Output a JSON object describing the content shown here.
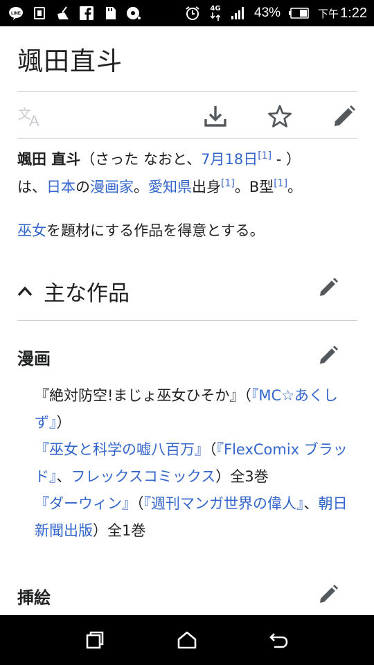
{
  "status_bar": {
    "battery_percent": "43%",
    "ampm": "下午",
    "time": "1:22",
    "network": "4G",
    "left_icons": [
      "line-icon",
      "sim-card-icon",
      "cleaner-icon",
      "facebook-icon",
      "sd-card-icon",
      "music-icon"
    ],
    "right_icons": [
      "alarm-icon",
      "data-arrows-icon",
      "signal-icon",
      "battery-icon"
    ]
  },
  "page": {
    "title": "颯田直斗",
    "actions": {
      "language": "language-icon",
      "download": "download-icon",
      "watch": "star-icon",
      "edit": "pencil-icon"
    }
  },
  "intro": {
    "name": "颯田 直斗",
    "reading_open": "（さった なおと、",
    "birthday_link": "7月18日",
    "ref1": "[1]",
    "reading_close": " - ）",
    "line2_start": "は、",
    "japan_link": "日本",
    "no": "の",
    "manga_artist_link": "漫画家",
    "period1": "。",
    "aichi_link": "愛知県",
    "born": "出身",
    "ref2": "[1]",
    "blood": "。B型",
    "ref3": "[1]",
    "period2": "。"
  },
  "intro2": {
    "miko_link": "巫女",
    "rest": "を題材にする作品を得意とする。"
  },
  "section_works": {
    "heading": "主な作品",
    "manga_heading": "漫画",
    "illust_heading": "挿絵"
  },
  "works": {
    "w1_title": "『絶対防空!まじょ巫女ひそか』",
    "w1_paren_open": "（",
    "w1_mag_link": "『MC☆あくしず』",
    "w1_paren_close": "）",
    "w2_title_link": "『巫女と科学の嘘八百万』",
    "w2_paren_open": "（",
    "w2_mag_link": "『FlexComix ブラッド』",
    "w2_sep": "、",
    "w2_label_link": "フレックスコミックス",
    "w2_tail": "）全3巻",
    "w3_title_link": "『ダーウィン』",
    "w3_paren_open": "（",
    "w3_series_link": "『週刊マンガ世界の偉人』",
    "w3_sep": "、",
    "w3_pub_link": "朝日新聞出版",
    "w3_tail": "）全1巻"
  },
  "nav_bar": {
    "recents": "recents-icon",
    "home": "home-icon",
    "back": "back-icon"
  },
  "colors": {
    "link": "#3366cc",
    "text": "#202122",
    "divider": "#c8ccd1",
    "icon": "#54595d"
  }
}
